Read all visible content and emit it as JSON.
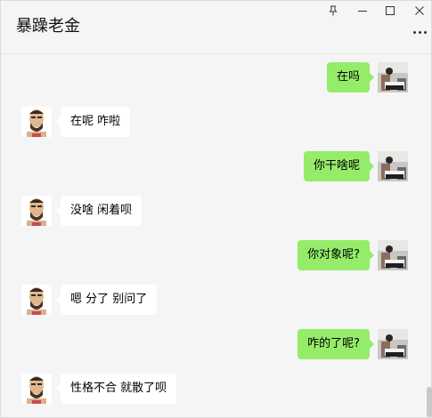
{
  "window": {
    "title": "暴躁老金",
    "controls": {
      "pin_icon": "pin-icon",
      "minimize_icon": "minimize-icon",
      "maximize_icon": "maximize-icon",
      "close_icon": "close-icon"
    },
    "more_icon": "more-icon"
  },
  "colors": {
    "my_bubble": "#95ec69",
    "other_bubble": "#ffffff",
    "background": "#f5f5f5"
  },
  "messages": [
    {
      "sender": "me",
      "text": "在吗"
    },
    {
      "sender": "other",
      "text": "在呢 咋啦"
    },
    {
      "sender": "me",
      "text": "你干啥呢"
    },
    {
      "sender": "other",
      "text": "没啥 闲着呗"
    },
    {
      "sender": "me",
      "text": "你对象呢?"
    },
    {
      "sender": "other",
      "text": "嗯 分了 别问了"
    },
    {
      "sender": "me",
      "text": "咋的了呢?"
    },
    {
      "sender": "other",
      "text": "性格不合 就散了呗"
    }
  ]
}
